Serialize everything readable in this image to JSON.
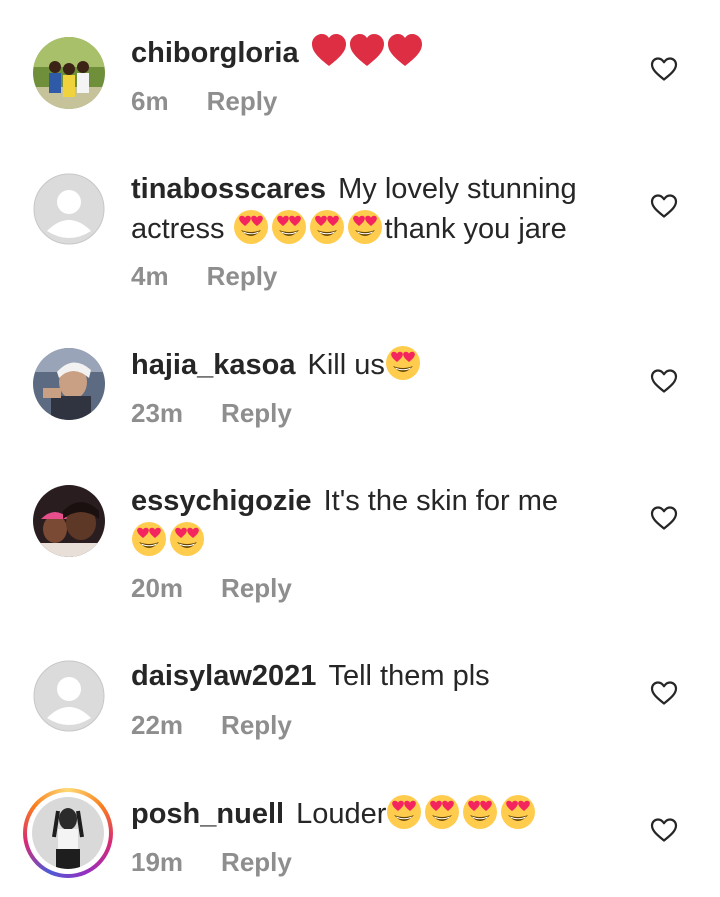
{
  "reply_label": "Reply",
  "comments": [
    {
      "username": "chiborgloria",
      "text_before": "",
      "emoji_hearts": 3,
      "emoji_faces": 0,
      "text_after": "",
      "time": "6m",
      "avatar": "photo"
    },
    {
      "username": "tinabosscares",
      "text_before": "My lovely stunning actress",
      "emoji_hearts": 0,
      "emoji_faces": 4,
      "text_after": "thank you jare",
      "time": "4m",
      "avatar": "default"
    },
    {
      "username": "hajia_kasoa",
      "text_before": "Kill us",
      "emoji_hearts": 0,
      "emoji_faces": 1,
      "text_after": "",
      "time": "23m",
      "avatar": "photo"
    },
    {
      "username": "essychigozie",
      "text_before": "It's the skin for me",
      "emoji_hearts": 0,
      "emoji_faces": 2,
      "text_after": "",
      "time": "20m",
      "avatar": "photo"
    },
    {
      "username": "daisylaw2021",
      "text_before": "Tell them pls",
      "emoji_hearts": 0,
      "emoji_faces": 0,
      "text_after": "",
      "time": "22m",
      "avatar": "default"
    },
    {
      "username": "posh_nuell",
      "text_before": "Louder",
      "emoji_hearts": 0,
      "emoji_faces": 4,
      "text_after": "",
      "time": "19m",
      "avatar": "story"
    }
  ],
  "colors": {
    "text": "#262626",
    "meta": "#8e8e8e",
    "heart_emoji": "#dd2e44",
    "face_emoji": "#ffcc4d",
    "eye_hearts": "#f4245e"
  },
  "icons": {
    "like": "heart-outline-icon",
    "heart_emoji": "red-heart-emoji",
    "face_emoji": "heart-eyes-emoji",
    "default_avatar": "default-avatar-icon"
  }
}
